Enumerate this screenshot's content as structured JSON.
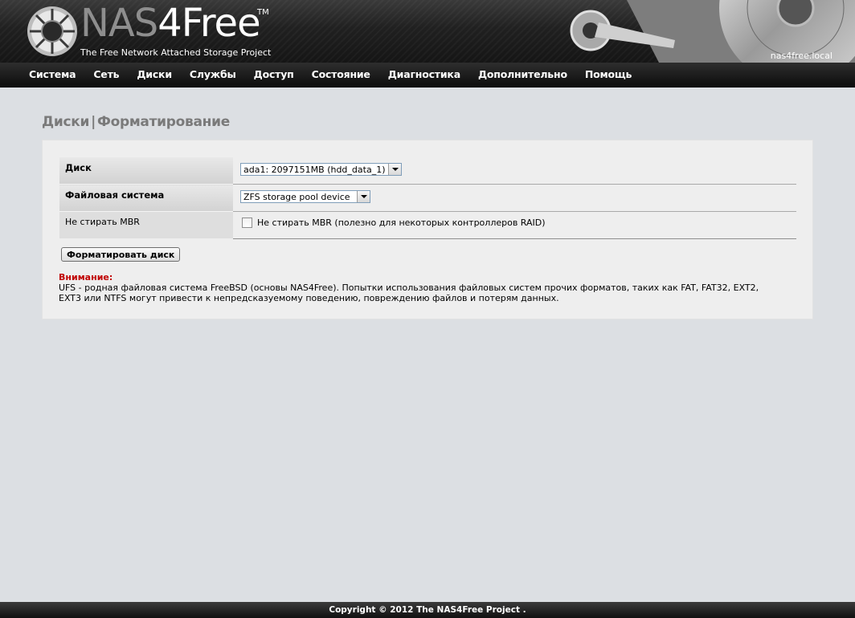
{
  "header": {
    "logo_nas": "NAS",
    "logo_free": "4Free",
    "logo_tm": "TM",
    "tagline": "The Free Network Attached Storage Project",
    "hostname": "nas4free.local"
  },
  "nav": {
    "items": [
      "Система",
      "Сеть",
      "Диски",
      "Службы",
      "Доступ",
      "Состояние",
      "Диагностика",
      "Дополнительно",
      "Помощь"
    ]
  },
  "page": {
    "title_part1": "Диски",
    "title_sep": "|",
    "title_part2": "Форматирование"
  },
  "form": {
    "disk_label": "Диск",
    "disk_value": "ada1: 2097151MB (hdd_data_1)",
    "fs_label": "Файловая система",
    "fs_value": "ZFS storage pool device",
    "mbr_label": "Не стирать MBR",
    "mbr_checkbox_text": "Не стирать MBR (полезно для некоторых контроллеров RAID)",
    "mbr_checked": false,
    "format_button": "Форматировать диск"
  },
  "warning": {
    "title": "Внимание:",
    "text": "UFS - родная файловая система FreeBSD (основы NAS4Free). Попытки использования файловых систем прочих форматов, таких как FAT, FAT32, EXT2, EXT3 или NTFS могут привести к непредсказуемому поведению, повреждению файлов и потерям данных."
  },
  "footer": {
    "copyright": "Copyright © 2012 The NAS4Free Project ."
  },
  "colors": {
    "background": "#dcdfe3",
    "panel": "#eeeeee",
    "title_gray": "#7a7a7a",
    "warning_red": "#c00000"
  }
}
